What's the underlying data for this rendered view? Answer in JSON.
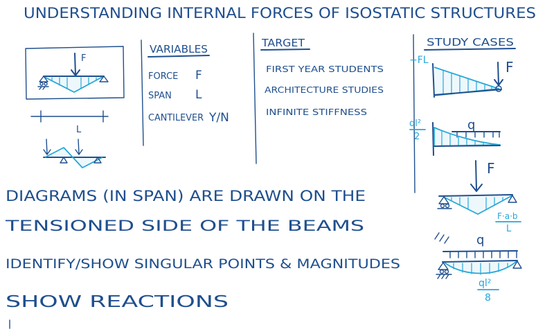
{
  "colors": {
    "ink": "#1f4f8e",
    "accent": "#26a7d8",
    "background": "#ffffff"
  },
  "title": "UNDERSTANDING INTERNAL FORCES OF ISOSTATIC STRUCTURES",
  "variables": {
    "heading": "VARIABLES",
    "rows": [
      {
        "name": "FORCE",
        "value": "F"
      },
      {
        "name": "SPAN",
        "value": "L"
      },
      {
        "name": "CANTILEVER",
        "value": "Y/N"
      }
    ]
  },
  "target": {
    "heading": "TARGET",
    "items": [
      "FIRST YEAR STUDENTS",
      "ARCHITECTURE STUDIES",
      "INFINITE STIFFNESS"
    ]
  },
  "study_cases": {
    "heading": "STUDY CASES",
    "labels": {
      "moment_fl": "−FL",
      "force_f": "F",
      "load_q": "q",
      "moment_ql2_num": "ql²",
      "moment_ql2_den": "2",
      "force_f_simple": "F",
      "moment_fab_num": "F·a·b",
      "moment_fab_den": "L",
      "load_q_simple": "q",
      "moment_ql28_num": "ql²",
      "moment_ql28_den": "8"
    }
  },
  "sketch": {
    "force_label": "F",
    "span_label": "L"
  },
  "notes": [
    "DIAGRAMS (IN SPAN) ARE DRAWN ON THE",
    "TENSIONED SIDE OF THE BEAMS",
    "IDENTIFY/SHOW SINGULAR POINTS & MAGNITUDES",
    "SHOW REACTIONS"
  ]
}
